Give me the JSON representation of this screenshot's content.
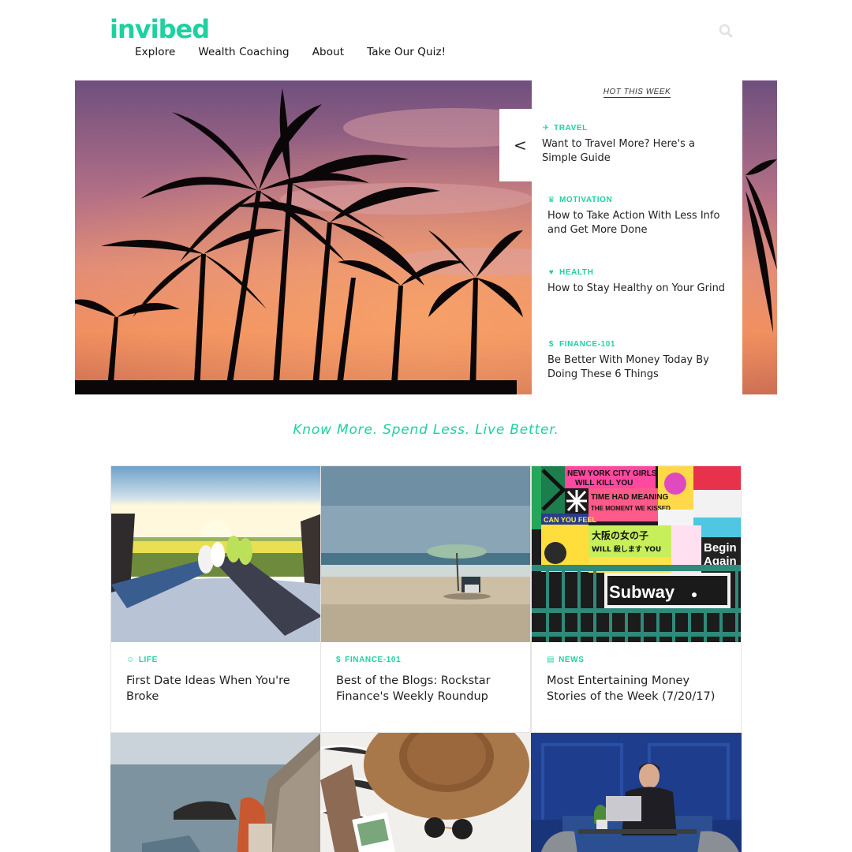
{
  "brand": {
    "logo_text": "invibed",
    "accent_color": "#1dd1a1"
  },
  "nav": {
    "items": [
      "Explore",
      "Wealth Coaching",
      "About",
      "Take Our Quiz!"
    ],
    "search_icon": "search-icon"
  },
  "hero": {
    "image": "palm-trees-sunset",
    "hot_title": "HOT THIS WEEK",
    "prev_label": "<",
    "items": [
      {
        "category": "TRAVEL",
        "icon": "plane-icon",
        "headline": "Want to Travel More? Here's a Simple Guide"
      },
      {
        "category": "MOTIVATION",
        "icon": "trophy-icon",
        "headline": "How to Take Action With Less Info and Get More Done"
      },
      {
        "category": "HEALTH",
        "icon": "heart-icon",
        "headline": "How to Stay Healthy on Your Grind"
      },
      {
        "category": "FINANCE-101",
        "icon": "dollar-icon",
        "headline": "Be Better With Money Today By Doing These 6 Things"
      }
    ]
  },
  "tagline": "Know More. Spend Less. Live Better.",
  "cards": [
    {
      "category": "LIFE",
      "icon": "smile-icon",
      "title": "First Date Ideas When You're Broke",
      "image": "couple-feet-car-field"
    },
    {
      "category": "FINANCE-101",
      "icon": "dollar-icon",
      "title": "Best of the Blogs: Rockstar Finance's Weekly Roundup",
      "image": "beach-umbrella"
    },
    {
      "category": "NEWS",
      "icon": "newspaper-icon",
      "title": "Most Entertaining Money Stories of the Week (7/20/17)",
      "image": "subway-posters"
    }
  ],
  "subway_poster": {
    "line1": "NEW YORK CITY GIRLS",
    "line2": "WILL KILL YOU",
    "line3": "TIME HAD MEANING",
    "line4": "THE MOMENT WE KISSED",
    "line5": "CAN YOU FEEL",
    "line6": "大阪の女の子",
    "line7": "WILL 殺します YOU",
    "line8": "Begin",
    "line9": "Again",
    "sign": "Subway"
  },
  "bottom_images": [
    "woman-on-rocks-sea",
    "hat-sunglasses-fur",
    "man-laptop-blue-room"
  ]
}
